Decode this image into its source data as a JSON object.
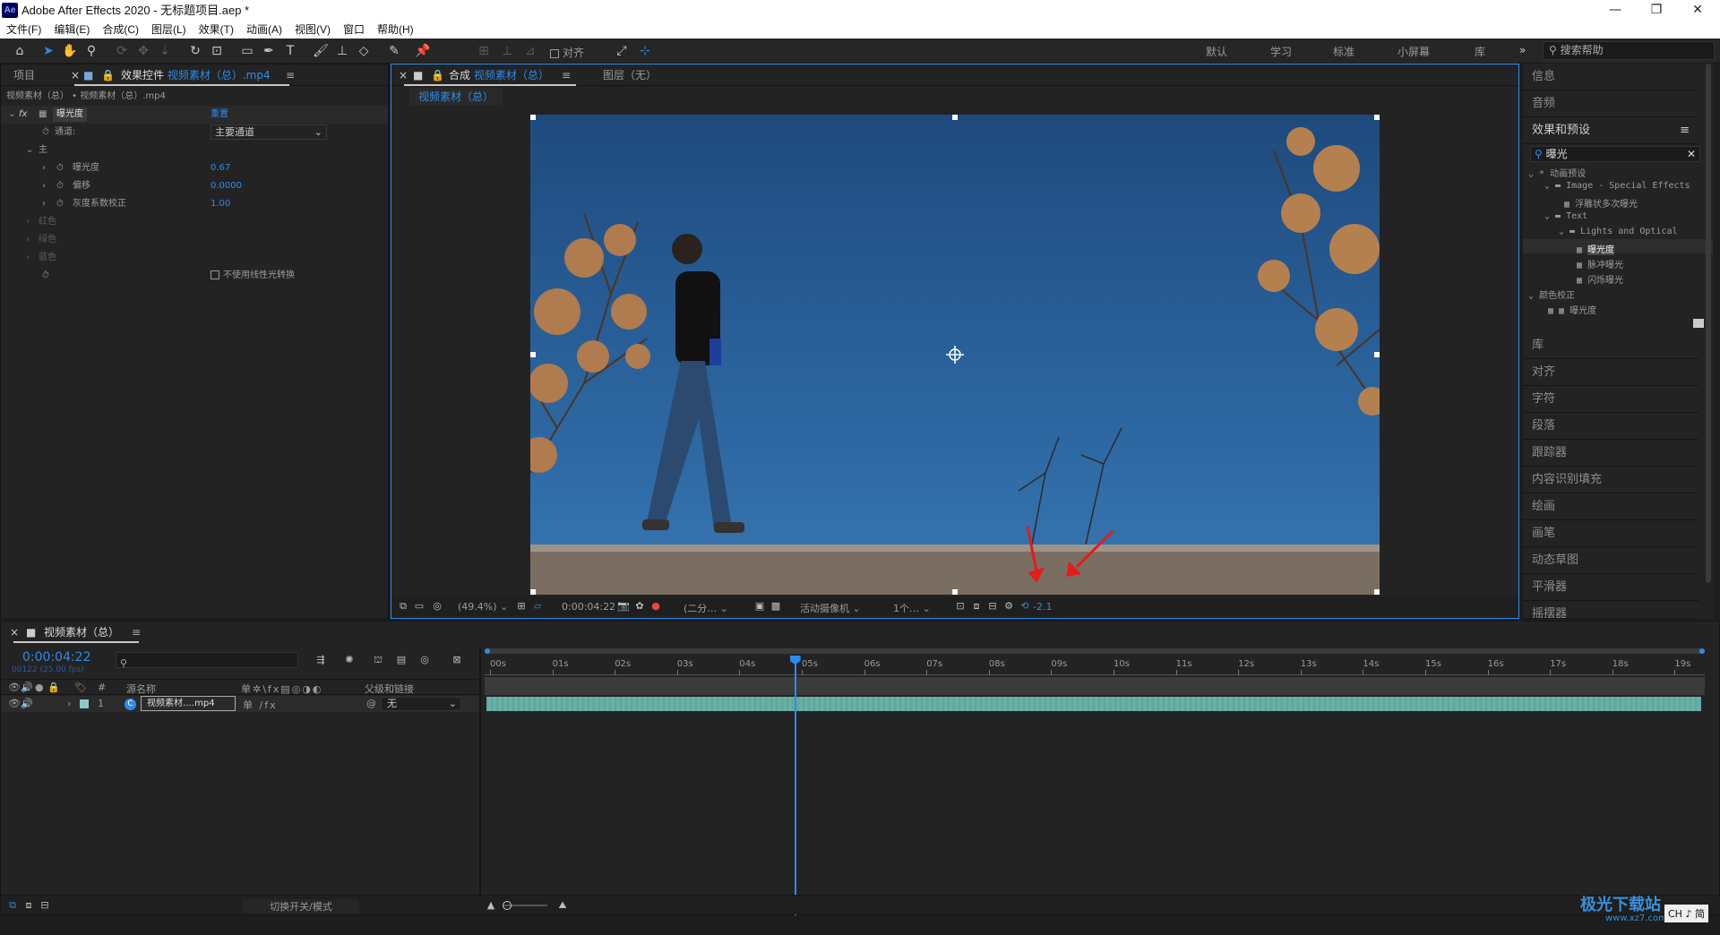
{
  "window": {
    "title": "Adobe After Effects 2020 - 无标题项目.aep *",
    "logo": "Ae",
    "min_icon": "minimize-icon",
    "max_icon": "restore-icon",
    "close_icon": "close-icon"
  },
  "menu": [
    "文件(F)",
    "编辑(E)",
    "合成(C)",
    "图层(L)",
    "效果(T)",
    "动画(A)",
    "视图(V)",
    "窗口",
    "帮助(H)"
  ],
  "toolbar": {
    "align_label": "对齐",
    "workspaces": [
      "默认",
      "学习",
      "标准",
      "小屏幕",
      "库"
    ],
    "more": "»",
    "search_placeholder": "搜索帮助"
  },
  "effects_panel": {
    "tab_project": "项目",
    "tab_effects_prefix": "效果控件",
    "tab_effects_source": "视频素材（总）.mp4",
    "breadcrumb": "视频素材（总） • 视频素材（总）.mp4",
    "effect_name": "曝光度",
    "reset_label": "重置",
    "channel_label": "通道:",
    "channel_value": "主要通道",
    "group_master": "主",
    "params": [
      {
        "label": "曝光度",
        "value": "0.67"
      },
      {
        "label": "偏移",
        "value": "0.0000"
      },
      {
        "label": "灰度系数校正",
        "value": "1.00"
      }
    ],
    "groups": [
      "红色",
      "绿色",
      "蓝色"
    ],
    "linear_checkbox": "不使用线性光转换"
  },
  "viewer": {
    "tab_comp_prefix": "合成",
    "tab_comp_name": "视频素材（总）",
    "tab_layer": "图层（无）",
    "crumb": "视频素材（总）",
    "zoom": "(49.4%)",
    "timecode": "0:00:04:22",
    "resolution": "(二分…",
    "camera": "活动摄像机",
    "views": "1个…",
    "exposure": "-2.1"
  },
  "right_panel": {
    "info": "信息",
    "audio": "音频",
    "effects_presets": "效果和预设",
    "search_value": "曝光",
    "tree": [
      {
        "text": "* 动画预设",
        "depth": 0
      },
      {
        "text": "Image - Special Effects",
        "depth": 1
      },
      {
        "text": "浮雕状多次曝光",
        "depth": 2
      },
      {
        "text": "Text",
        "depth": 1
      },
      {
        "text": "Lights and Optical",
        "depth": 2
      },
      {
        "text": "曝光度",
        "depth": 3,
        "selected": true
      },
      {
        "text": "脉冲曝光",
        "depth": 3
      },
      {
        "text": "闪烁曝光",
        "depth": 3
      },
      {
        "text": "颜色校正",
        "depth": 0
      },
      {
        "text": "曝光度",
        "depth": 1
      }
    ],
    "panels": [
      "库",
      "对齐",
      "字符",
      "段落",
      "跟踪器",
      "内容识别填充",
      "绘画",
      "画笔",
      "动态草图",
      "平滑器",
      "摇摆器"
    ]
  },
  "timeline": {
    "tab_name": "视频素材（总）",
    "timecode": "0:00:04:22",
    "frame_info": "00122 (25.00 fps)",
    "col_source": "源名称",
    "col_parent": "父级和链接",
    "layer_num": "1",
    "layer_name": "视频素材….mp4",
    "parent_value": "无",
    "ticks": [
      "00s",
      "01s",
      "02s",
      "03s",
      "04s",
      "05s",
      "06s",
      "07s",
      "08s",
      "09s",
      "10s",
      "11s",
      "12s",
      "13s",
      "14s",
      "15s",
      "16s",
      "17s",
      "18s",
      "19s"
    ],
    "playhead_seconds": 4.88,
    "toggle_label": "切换开关/模式"
  },
  "ime": {
    "label": "CH ♪ 简"
  },
  "watermark": {
    "text": "极光下载站",
    "url": "www.xz7.com"
  }
}
